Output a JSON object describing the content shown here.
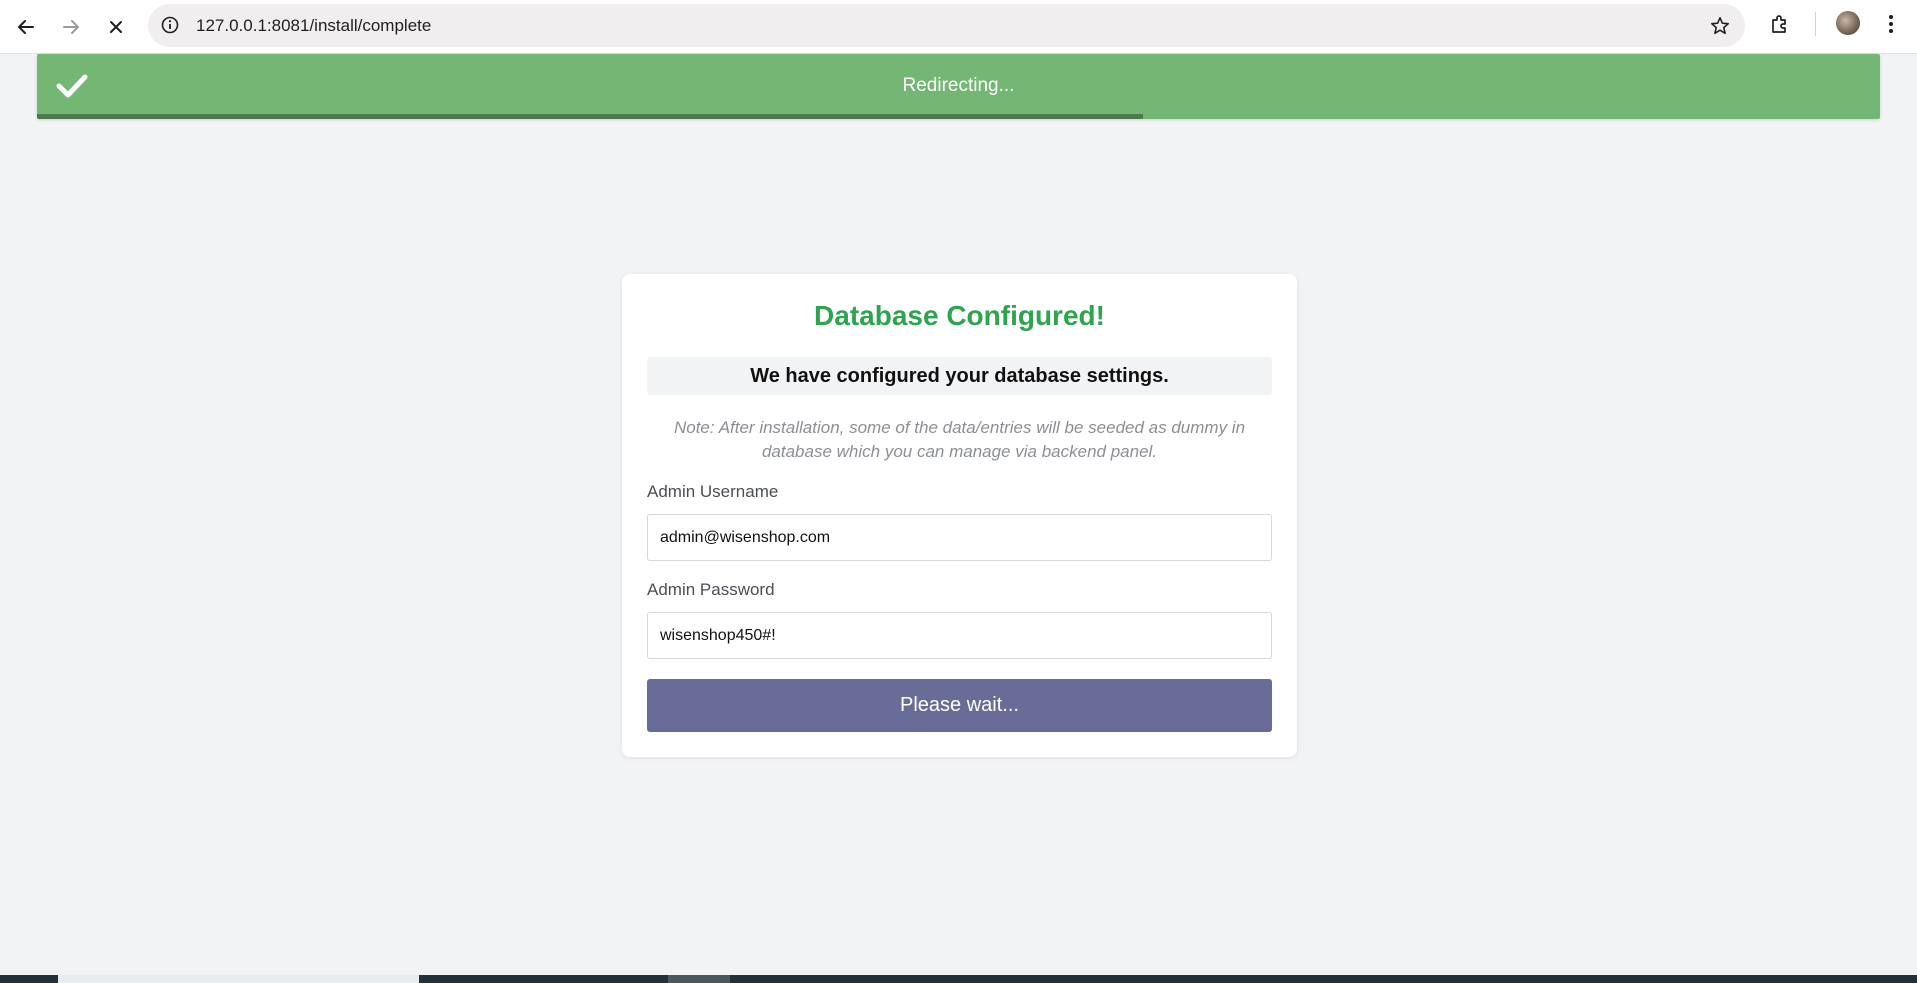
{
  "browser": {
    "url": "127.0.0.1:8081/install/complete",
    "icons": {
      "back": "arrow-left-icon",
      "forward": "arrow-right-icon",
      "stop": "close-icon",
      "site_info": "info-icon",
      "bookmark": "star-icon",
      "extensions": "puzzle-icon",
      "menu": "kebab-menu-icon"
    }
  },
  "toast": {
    "message": "Redirecting...",
    "icon": "checkmark-icon",
    "progress": 0.6,
    "color": "#74b673"
  },
  "card": {
    "title": "Database Configured!",
    "subtitle": "We have configured your database settings.",
    "note": "Note: After installation, some of the data/entries will be seeded as dummy in database which you can manage via backend panel.",
    "fields": [
      {
        "label": "Admin Username",
        "value": "admin@wisenshop.com"
      },
      {
        "label": "Admin Password",
        "value": "wisenshop450#!"
      }
    ],
    "button_label": "Please wait..."
  },
  "colors": {
    "title_green": "#2ea44f",
    "button": "#696c96",
    "background": "#f2f3f5"
  }
}
